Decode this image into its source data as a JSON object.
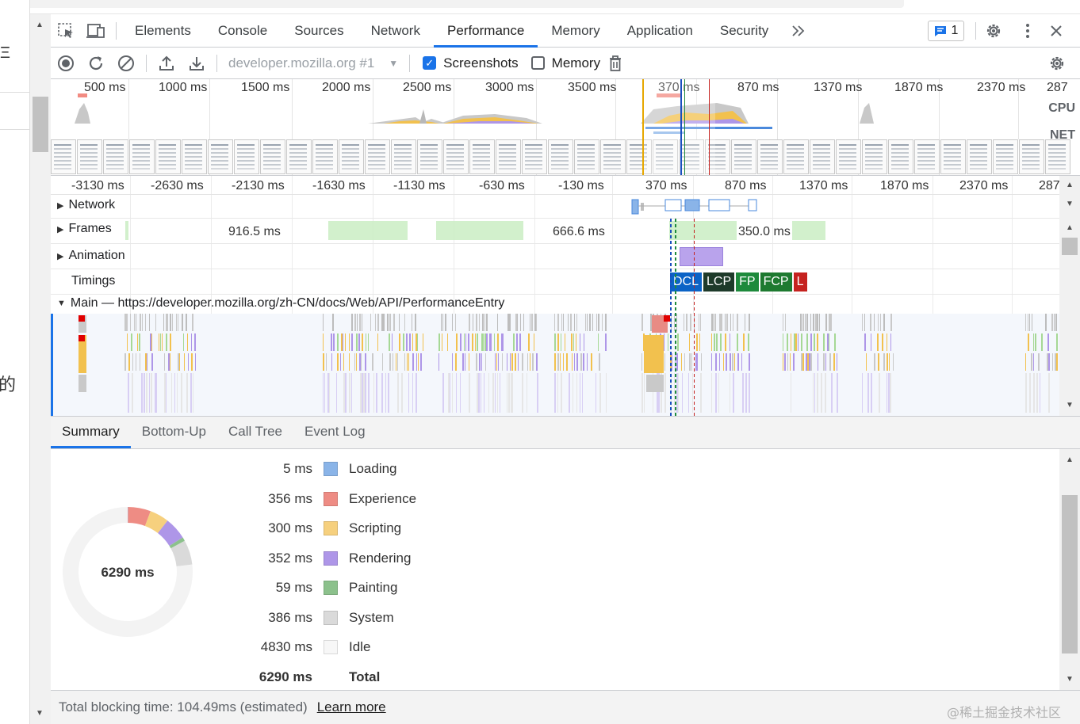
{
  "devtools": {
    "tabs": [
      "Elements",
      "Console",
      "Sources",
      "Network",
      "Performance",
      "Memory",
      "Application",
      "Security"
    ],
    "active_tab": "Performance",
    "more_tabs_icon": "chevron-double-right-icon",
    "issues_count": "1"
  },
  "toolbar": {
    "target": "developer.mozilla.org #1",
    "screenshots_label": "Screenshots",
    "screenshots_checked": true,
    "memory_label": "Memory",
    "memory_checked": false
  },
  "overview": {
    "ticks": [
      "500 ms",
      "1000 ms",
      "1500 ms",
      "2000 ms",
      "2500 ms",
      "3000 ms",
      "3500 ms",
      "370 ms",
      "870 ms",
      "1370 ms",
      "1870 ms",
      "2370 ms",
      "287"
    ],
    "cpu_label": "CPU",
    "net_label": "NET"
  },
  "timeline": {
    "ticks": [
      "-3130 ms",
      "-2630 ms",
      "-2130 ms",
      "-1630 ms",
      "-1130 ms",
      "-630 ms",
      "-130 ms",
      "370 ms",
      "870 ms",
      "1370 ms",
      "1870 ms",
      "2370 ms",
      "287"
    ],
    "tracks": {
      "network": "Network",
      "frames": "Frames",
      "animation": "Animation",
      "timings": "Timings",
      "main": "Main — https://developer.mozilla.org/zh-CN/docs/Web/API/PerformanceEntry"
    },
    "frame_values": [
      "916.5 ms",
      "666.6 ms",
      "350.0 ms"
    ],
    "markers": [
      {
        "label": "DCL",
        "color": "#0b63c6"
      },
      {
        "label": "LCP",
        "color": "#1e3a2a"
      },
      {
        "label": "FP",
        "color": "#1e8a3c"
      },
      {
        "label": "FCP",
        "color": "#1e7a30"
      },
      {
        "label": "L",
        "color": "#c5221f"
      }
    ]
  },
  "summary": {
    "tabs": [
      "Summary",
      "Bottom-Up",
      "Call Tree",
      "Event Log"
    ],
    "active_tab": "Summary",
    "total_center": "6290 ms",
    "rows": [
      {
        "value": "5 ms",
        "label": "Loading",
        "color": "#8ab4e8",
        "ms": 5
      },
      {
        "value": "356 ms",
        "label": "Experience",
        "color": "#ee8c84",
        "ms": 356
      },
      {
        "value": "300 ms",
        "label": "Scripting",
        "color": "#f6d07e",
        "ms": 300
      },
      {
        "value": "352 ms",
        "label": "Rendering",
        "color": "#ae96e8",
        "ms": 352
      },
      {
        "value": "59 ms",
        "label": "Painting",
        "color": "#8cc18c",
        "ms": 59
      },
      {
        "value": "386 ms",
        "label": "System",
        "color": "#dadada",
        "ms": 386
      },
      {
        "value": "4830 ms",
        "label": "Idle",
        "color": "#f7f7f7",
        "ms": 4830
      }
    ],
    "total_value": "6290 ms",
    "total_label": "Total"
  },
  "footer": {
    "text": "Total blocking time: 104.49ms (estimated)",
    "link": "Learn more",
    "watermark": "@稀土掘金技术社区"
  },
  "page": {
    "glyph_top": "Ξ",
    "glyph_bottom": "的"
  }
}
